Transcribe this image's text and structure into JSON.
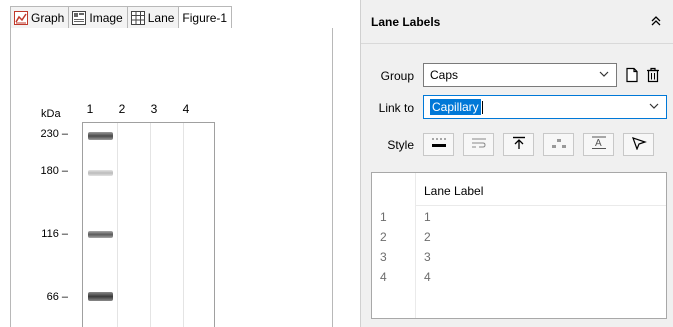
{
  "tabs": [
    {
      "label": "Graph",
      "icon": "graph-icon"
    },
    {
      "label": "Image",
      "icon": "image-icon"
    },
    {
      "label": "Lane",
      "icon": "lane-grid-icon"
    },
    {
      "label": "Figure-1",
      "icon": ""
    }
  ],
  "gel_view": {
    "unit_label": "kDa",
    "lane_numbers": [
      "1",
      "2",
      "3",
      "4"
    ],
    "mw_markers": [
      {
        "label": "230 –",
        "value": 230
      },
      {
        "label": "180 –",
        "value": 180
      },
      {
        "label": "116 –",
        "value": 116
      },
      {
        "label": "66 –",
        "value": 66
      }
    ]
  },
  "panel": {
    "title": "Lane Labels",
    "group_label": "Group",
    "group_value": "Caps",
    "link_label": "Link to",
    "link_value": "Capillary",
    "style_label": "Style",
    "style_buttons": [
      "style-lines-icon",
      "style-wrap-icon",
      "style-align-top-icon",
      "style-dash-icon",
      "style-text-underline-icon",
      "style-pointer-icon"
    ]
  },
  "lane_table": {
    "header": "Lane Label",
    "rows": [
      {
        "num": "1",
        "label": "1"
      },
      {
        "num": "2",
        "label": "2"
      },
      {
        "num": "3",
        "label": "3"
      },
      {
        "num": "4",
        "label": "4"
      }
    ]
  },
  "colors": {
    "selection": "#0078d7",
    "panel_bg": "#f0f0f0"
  }
}
